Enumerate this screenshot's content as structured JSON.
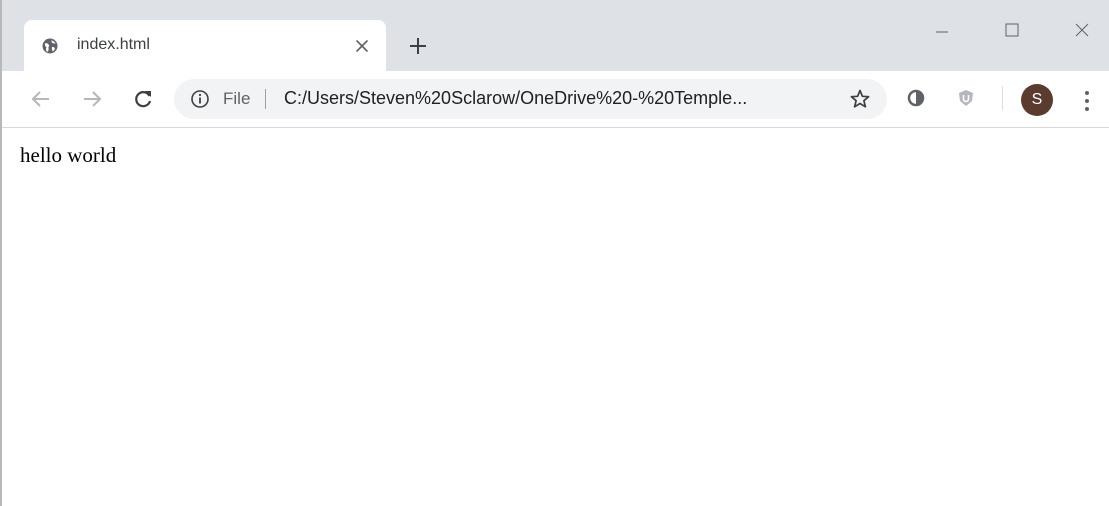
{
  "tab": {
    "title": "index.html",
    "favicon": "globe-icon"
  },
  "window_controls": {
    "minimize": "minimize-icon",
    "maximize": "maximize-icon",
    "close": "close-icon"
  },
  "omnibox": {
    "scheme_label": "File",
    "url": "C:/Users/Steven%20Sclarow/OneDrive%20-%20Temple..."
  },
  "profile": {
    "initial": "S",
    "color": "#5b3b2f"
  },
  "page": {
    "text": "hello world"
  }
}
